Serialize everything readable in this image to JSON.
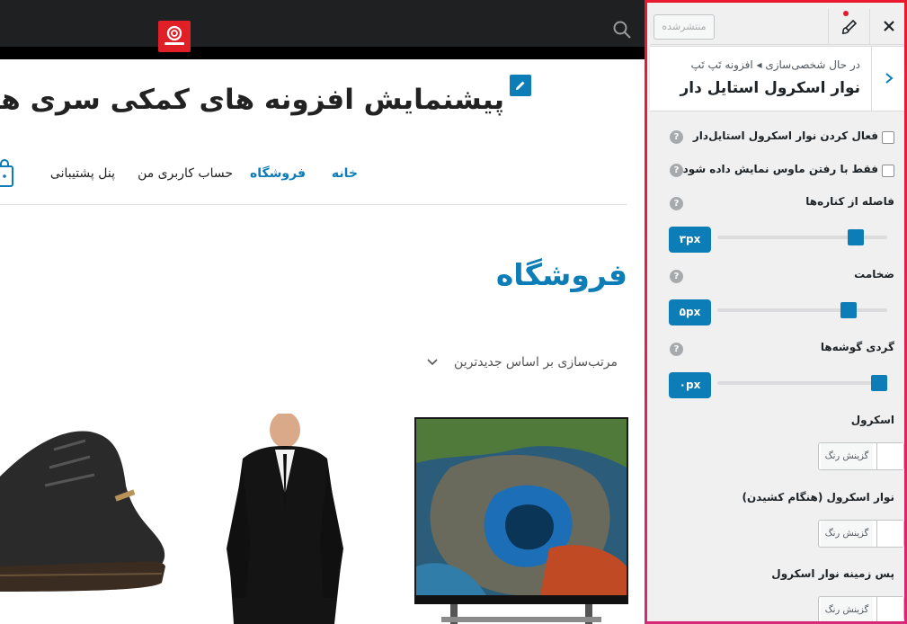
{
  "site": {
    "title": "پیشنمایش افزونه های کمکی سری هشتم",
    "nav": {
      "home": "خانه",
      "shop": "فروشگاه",
      "account": "حساب کاربری من",
      "support": "پنل پشتیبانی"
    },
    "page_title": "فروشگاه",
    "sort_label": "مرتب‌سازی بر اساس جدیدترین"
  },
  "panel": {
    "publish_label": "منتشرشده",
    "breadcrumb": "در حال شخصی‌سازی ◂ افزونه تَپ تَپ",
    "section_title": "نوار اسکرول استایل دار",
    "controls": {
      "enable_label": "فعال کردن نوار اسکرول استایل‌دار",
      "hover_only_label": "فقط با رفتن ماوس نمایش داده شود",
      "margin_label": "فاصله از کناره‌ها",
      "margin_value": "۳px",
      "margin_fraction": 0.85,
      "thickness_label": "ضخامت",
      "thickness_value": "۵px",
      "thickness_fraction": 0.8,
      "radius_label": "گردی گوشه‌ها",
      "radius_value": "۰px",
      "radius_fraction": 1.0,
      "scroll_color_label": "اسکرول",
      "drag_color_label": "نوار اسکرول (هنگام کشیدن)",
      "bg_color_label": "پس زمینه نوار اسکرول",
      "choose_color": "گزینش رنگ",
      "help": "?"
    }
  },
  "colors": {
    "accent": "#0c7db6",
    "panel_border_top": "#e8192c",
    "panel_border_bottom": "#d62876",
    "topbar": "#1f2022",
    "logo": "#e01f26"
  }
}
